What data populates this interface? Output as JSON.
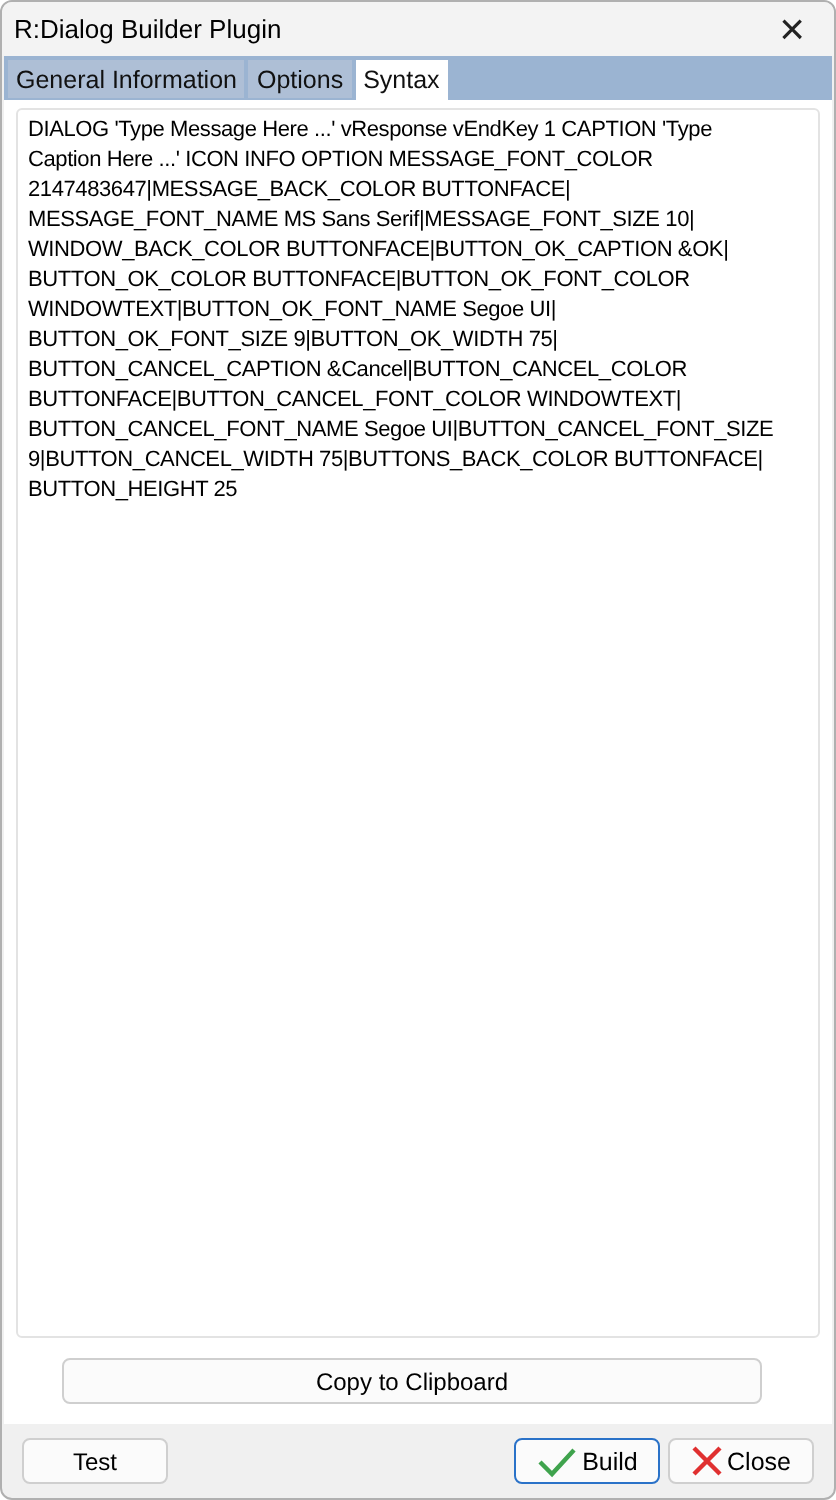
{
  "window": {
    "title": "R:Dialog Builder Plugin",
    "close": "×"
  },
  "tabs": [
    {
      "label": "General Information",
      "selected": false
    },
    {
      "label": "Options",
      "selected": false
    },
    {
      "label": "Syntax",
      "selected": true
    }
  ],
  "syntax_lines": [
    "DIALOG 'Type Message Here ...' vResponse vEndKey  1  CAPTION 'Type",
    "Caption Here ...' ICON INFO OPTION MESSAGE_FONT_COLOR",
    "2147483647|MESSAGE_BACK_COLOR BUTTONFACE|",
    "MESSAGE_FONT_NAME MS Sans Serif|MESSAGE_FONT_SIZE 10|",
    "WINDOW_BACK_COLOR BUTTONFACE|BUTTON_OK_CAPTION &OK|",
    "BUTTON_OK_COLOR BUTTONFACE|BUTTON_OK_FONT_COLOR",
    "WINDOWTEXT|BUTTON_OK_FONT_NAME Segoe UI|",
    "BUTTON_OK_FONT_SIZE 9|BUTTON_OK_WIDTH 75|",
    "BUTTON_CANCEL_CAPTION &Cancel|BUTTON_CANCEL_COLOR",
    "BUTTONFACE|BUTTON_CANCEL_FONT_COLOR WINDOWTEXT|",
    "BUTTON_CANCEL_FONT_NAME Segoe UI|BUTTON_CANCEL_FONT_SIZE",
    "9|BUTTON_CANCEL_WIDTH 75|BUTTONS_BACK_COLOR BUTTONFACE|",
    "BUTTON_HEIGHT 25"
  ],
  "copy_button": "Copy to Clipboard",
  "footer_buttons": [
    {
      "kind": "plain",
      "label": "Test"
    },
    {
      "kind": "build",
      "label": "Build"
    },
    {
      "kind": "close",
      "label": "Close"
    }
  ]
}
